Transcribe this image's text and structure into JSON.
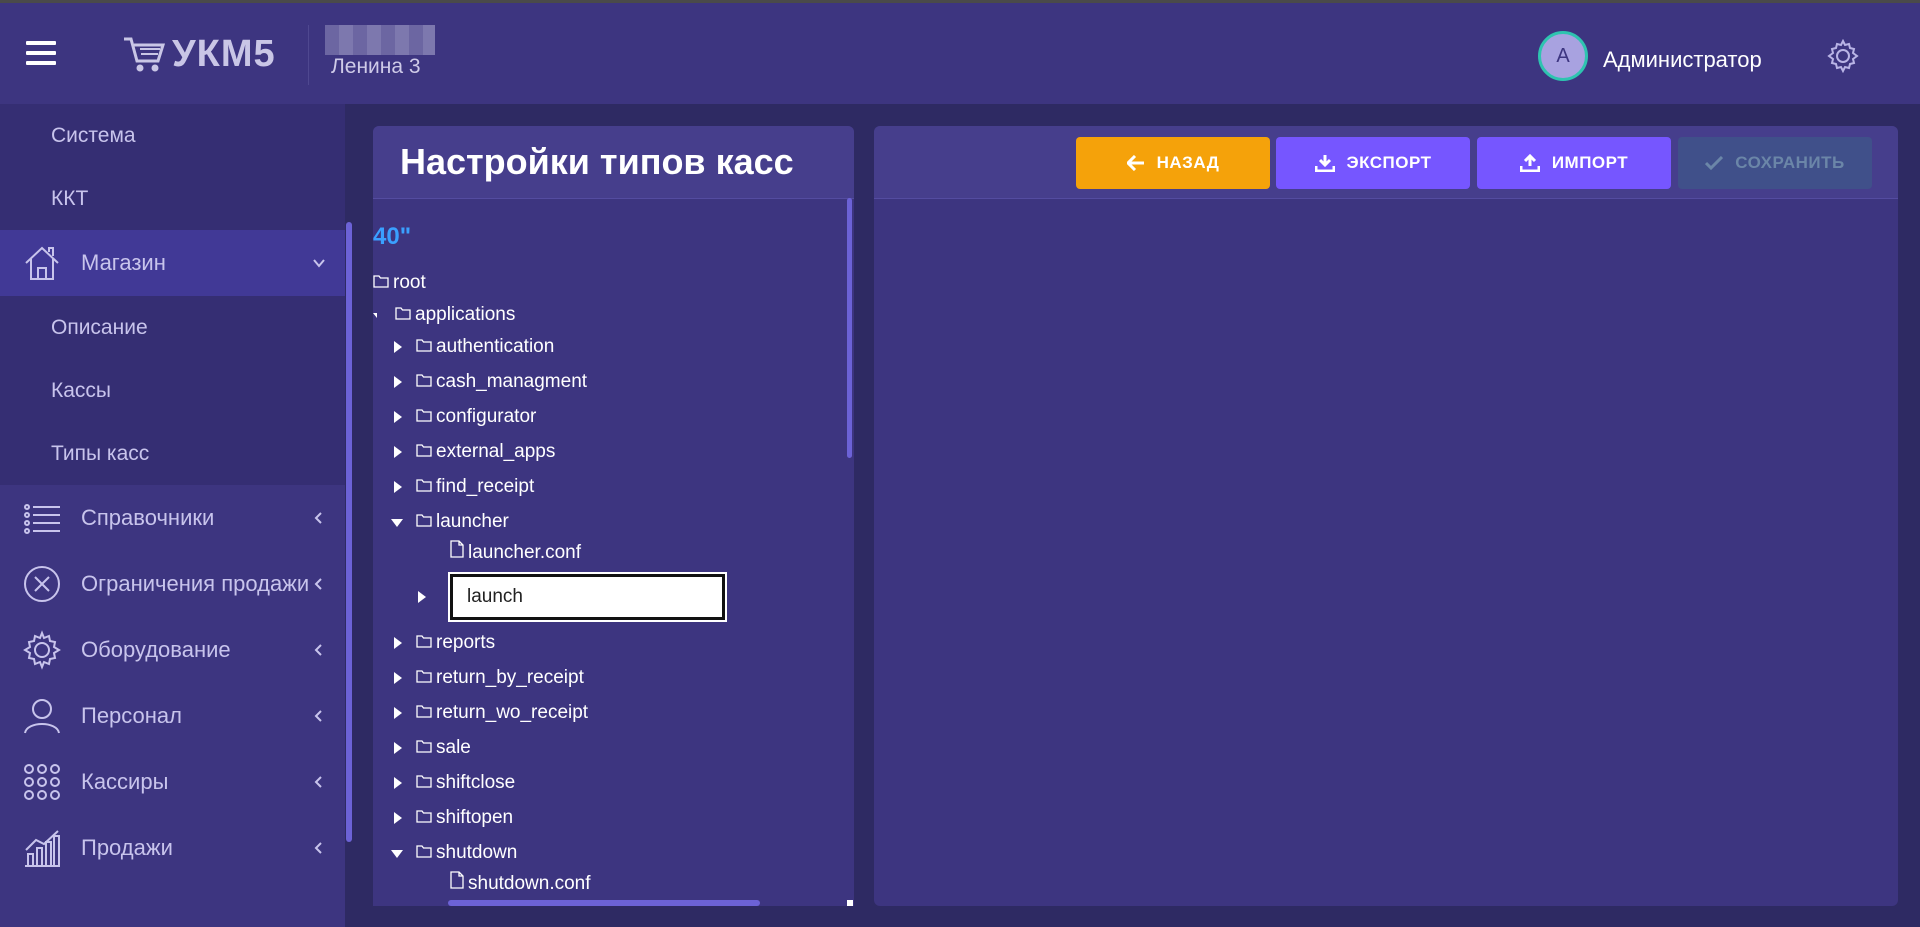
{
  "header": {
    "logo_text": "УКМ5",
    "store_name": "Ленина 3",
    "avatar_letter": "А",
    "user_name": "Администратор"
  },
  "sidebar": {
    "top_subitems": [
      "Система",
      "ККТ"
    ],
    "store_menu": {
      "label": "Магазин",
      "icon": "house-icon"
    },
    "store_subitems": [
      "Описание",
      "Кассы",
      "Типы касс"
    ],
    "menu": [
      {
        "label": "Справочники",
        "icon": "list-icon"
      },
      {
        "label": "Ограничения продажи",
        "icon": "circle-x-icon"
      },
      {
        "label": "Оборудование",
        "icon": "gear-icon"
      },
      {
        "label": "Персонал",
        "icon": "person-icon"
      },
      {
        "label": "Кассиры",
        "icon": "grid-dots-icon"
      },
      {
        "label": "Продажи",
        "icon": "chart-icon"
      }
    ]
  },
  "tree": {
    "title": "Настройки типов касс",
    "caption": "40\"",
    "nodes": {
      "root": "root",
      "applications": "applications",
      "authentication": "authentication",
      "cash_managment": "cash_managment",
      "configurator": "configurator",
      "external_apps": "external_apps",
      "find_receipt": "find_receipt",
      "launcher": "launcher",
      "launcher_conf": "launcher.conf",
      "reports": "reports",
      "return_by_receipt": "return_by_receipt",
      "return_wo_receipt": "return_wo_receipt",
      "sale": "sale",
      "shiftclose": "shiftclose",
      "shiftopen": "shiftopen",
      "shutdown": "shutdown",
      "shutdown_conf": "shutdown.conf"
    },
    "rename_value": "launch"
  },
  "toolbar": {
    "back_label": "НАЗАД",
    "export_label": "ЭКСПОРТ",
    "import_label": "ИМПОРТ",
    "save_label": "СОХРАНИТЬ"
  },
  "colors": {
    "background": "#2e2a63",
    "panel": "#3d3580",
    "accent_orange": "#f5a20a",
    "accent_purple": "#7656ff",
    "disabled": "#40508a",
    "link_blue": "#3aa0ff"
  }
}
